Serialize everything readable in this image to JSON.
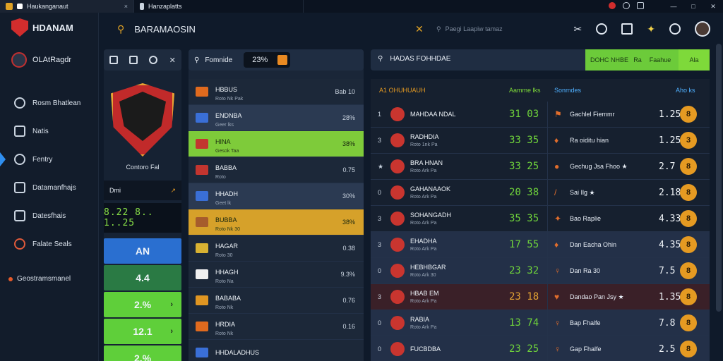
{
  "titlebar": {
    "tab1": "Haukanganaut",
    "tab2": "Hanzaplatts",
    "close": "×",
    "controls": [
      "—",
      "□",
      "✕"
    ]
  },
  "brand": {
    "name": "HDANAM"
  },
  "account": {
    "name": "OLAtRagdr"
  },
  "nav": {
    "items": [
      {
        "label": "Rosm Bhatlean"
      },
      {
        "label": "Natis"
      },
      {
        "label": "Fentry"
      },
      {
        "label": "Datamanfhajs"
      },
      {
        "label": "Datesfhais"
      },
      {
        "label": "Falate Seals"
      }
    ],
    "footer": "Geostramsmanel"
  },
  "topbar": {
    "title": "BARAMAOSIN",
    "search_placeholder": "Paegi Laapiw tamaz"
  },
  "team_panel": {
    "team_name": "Contoro Fal",
    "mini_label": "Dmi",
    "mini_arrow": "↗",
    "score": "8.22 8.. 1..25",
    "buttons": [
      {
        "value": "AN",
        "left": "",
        "right": ""
      },
      {
        "value": "4.4",
        "left": "",
        "right": ""
      },
      {
        "value": "2.%",
        "left": "",
        "right": "›"
      },
      {
        "value": "12.1",
        "left": "",
        "right": "›"
      },
      {
        "value": "2.%",
        "left": "",
        "right": ""
      }
    ]
  },
  "list_panel": {
    "search_label": "Fomnide",
    "pill_value": "23%",
    "rows": [
      {
        "name": "HBBUS",
        "sub": "Roto Nk Pak",
        "value": "Bab 10",
        "flag": "#e06a1e",
        "bg": "#1c2839"
      },
      {
        "name": "ENDNBA",
        "sub": "Geer lks",
        "value": "28%",
        "flag": "#3a6fd6",
        "bg": "#2b3a52"
      },
      {
        "name": "HINA",
        "sub": "Gesok Taa",
        "value": "38%",
        "flag": "#c3352f",
        "bg": "#7ecb3a"
      },
      {
        "name": "BABBA",
        "sub": "Roto",
        "value": "0.75",
        "flag": "#c3352f",
        "bg": "#1c2839"
      },
      {
        "name": "HHADH",
        "sub": "Geet lk",
        "value": "30%",
        "flag": "#3a6fd6",
        "bg": "#2b3a52"
      },
      {
        "name": "BUBBA",
        "sub": "Roto Nk 30",
        "value": "38%",
        "flag": "#a65c2c",
        "bg": "#d6a12a"
      },
      {
        "name": "HAGAR",
        "sub": "Roto 30",
        "value": "0.38",
        "flag": "#d8b232",
        "bg": "#1c2839"
      },
      {
        "name": "HHAGH",
        "sub": "Roto Na",
        "value": "9.3%",
        "flag": "#f0f0f0",
        "bg": "#1c2839"
      },
      {
        "name": "BABABA",
        "sub": "Roto Nk",
        "value": "0.76",
        "flag": "#e09622",
        "bg": "#1c2839"
      },
      {
        "name": "HRDIA",
        "sub": "Roto Nk",
        "value": "0.16",
        "flag": "#e06a1e",
        "bg": "#1c2839"
      },
      {
        "name": "HHDALADHUS",
        "sub": "",
        "value": "",
        "flag": "#3a6fd6",
        "bg": "#1c2839"
      }
    ]
  },
  "search_panel": {
    "label": "HADAS FOHHDAE",
    "btn1": "DOHC NHBE",
    "btn2": "Ra",
    "btn3": "Faahue",
    "btn4": "Ala"
  },
  "table": {
    "headers": {
      "team": "A1 OHUHUAUH",
      "score": "Aamme lks",
      "events": "Sonmdes",
      "odds": "Aho ks"
    },
    "rows": [
      {
        "rank": "1",
        "name": "MAHDAA NDAL",
        "sub": "",
        "score": "31 03",
        "icon": "⚑",
        "event": "Gachlel Fiemmr",
        "value": "1.25",
        "badge": "8",
        "bg": "#16202f",
        "score_color": "#6fd33b"
      },
      {
        "rank": "3",
        "name": "RADHDIA",
        "sub": "Roto 1nk Pa",
        "score": "33 35",
        "icon": "♦",
        "event": "Ra oiditu hian",
        "value": "1.25",
        "badge": "3",
        "bg": "#16202f",
        "score_color": "#6fd33b"
      },
      {
        "rank": "★",
        "name": "BRA HNAN",
        "sub": "Roto Ark Pa",
        "score": "33 25",
        "icon": "●",
        "event": "Gechug Jsa Fhoo ★",
        "value": "2.7",
        "badge": "8",
        "bg": "#16202f",
        "score_color": "#6fd33b"
      },
      {
        "rank": "0",
        "name": "GAHANAAOK",
        "sub": "Roto Ark Pa",
        "score": "20 38",
        "icon": "/",
        "event": "Sai Ilg ★",
        "value": "2.18",
        "badge": "8",
        "bg": "#16202f",
        "score_color": "#6fd33b"
      },
      {
        "rank": "3",
        "name": "SOHANGADH",
        "sub": "Roto Ark Pa",
        "score": "35 35",
        "icon": "✦",
        "event": "Bao Raplie",
        "value": "4.33",
        "badge": "8",
        "bg": "#16202f",
        "score_color": "#6fd33b"
      },
      {
        "rank": "3",
        "name": "EHADHA",
        "sub": "Roto Ark Pa",
        "score": "17 55",
        "icon": "♦",
        "event": "Dan Eacha Ohin",
        "value": "4.35",
        "badge": "8",
        "bg": "#233048",
        "score_color": "#6fd33b"
      },
      {
        "rank": "0",
        "name": "HEBHBGAR",
        "sub": "Roto Ark 30",
        "score": "23 32",
        "icon": "♀",
        "event": "Dan Ra 30",
        "value": "7.5",
        "badge": "8",
        "bg": "#233048",
        "score_color": "#6fd33b"
      },
      {
        "rank": "3",
        "name": "HBAB EM",
        "sub": "Roto Ark Pa",
        "score": "23 18",
        "icon": "♥",
        "event": "Dandao Pan Jsy ★",
        "value": "1.35",
        "badge": "8",
        "bg": "#3a2028",
        "score_color": "#e5a534"
      },
      {
        "rank": "0",
        "name": "RABIA",
        "sub": "Roto Ark Pa",
        "score": "13 74",
        "icon": "♀",
        "event": "Bap Fhalfe",
        "value": "7.8",
        "badge": "8",
        "bg": "#233048",
        "score_color": "#6fd33b"
      },
      {
        "rank": "0",
        "name": "FUCBDBA",
        "sub": "",
        "score": "23 25",
        "icon": "♀",
        "event": "Gap Fhalfe",
        "value": "2.5",
        "badge": "8",
        "bg": "#233048",
        "score_color": "#6fd33b"
      }
    ]
  },
  "colors": {
    "accent": "#2f8ff0",
    "green": "#6ccb3a",
    "orange": "#e59a22"
  }
}
